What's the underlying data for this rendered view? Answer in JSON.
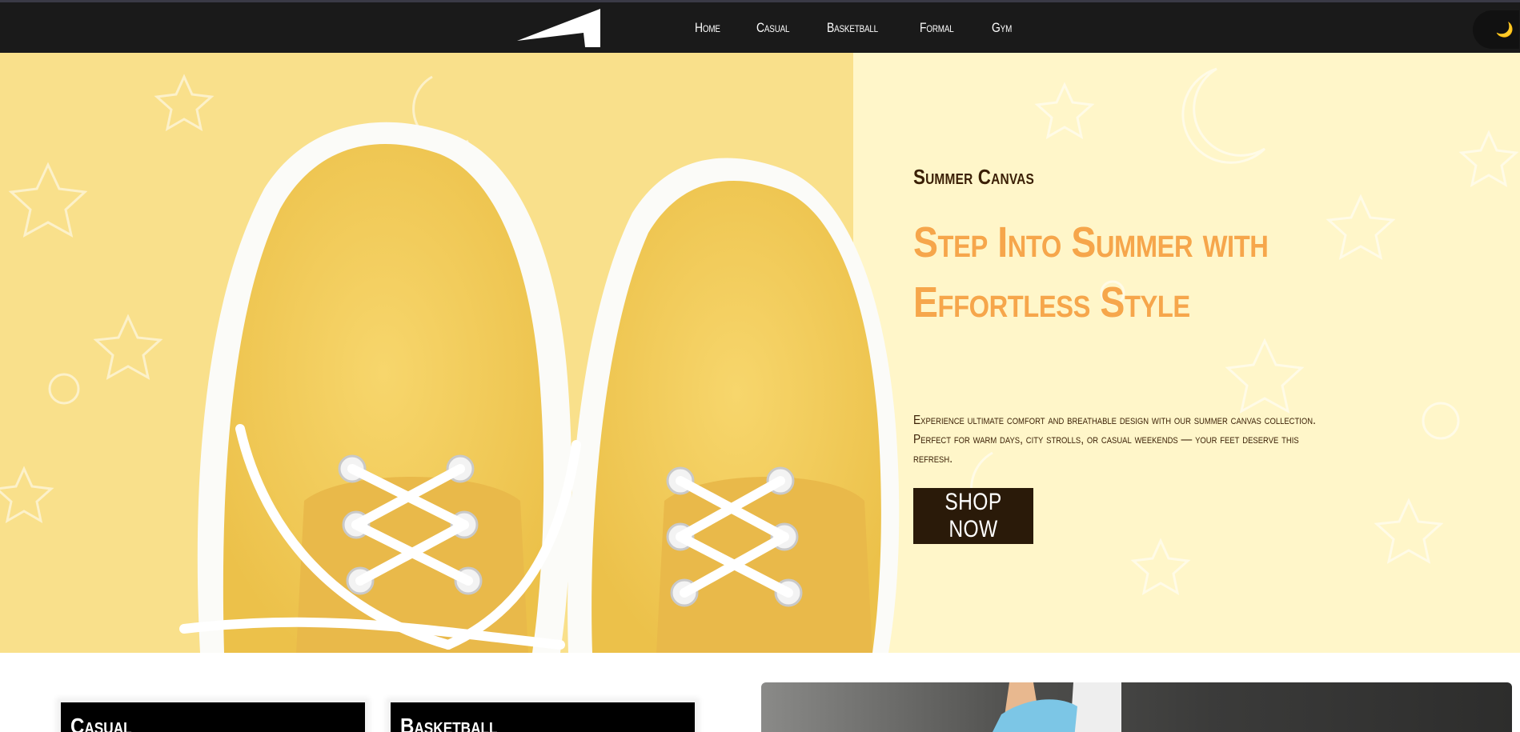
{
  "nav": {
    "items": [
      {
        "label": "Home"
      },
      {
        "label": "Casual"
      },
      {
        "label": "Basketball"
      },
      {
        "label": "Formal"
      },
      {
        "label": "Gym"
      }
    ],
    "theme_toggle_icon": "moon-icon"
  },
  "hero": {
    "eyebrow": "Summer Canvas",
    "headline": "Step Into Summer with Effortless Style",
    "description": "Experience ultimate comfort and breathable design with our summer canvas collection. Perfect for warm days, city strolls, or casual weekends — your feet deserve this refresh.",
    "cta_label": "SHOP NOW"
  },
  "categories": [
    {
      "label": "Casual"
    },
    {
      "label": "Basketball"
    }
  ],
  "colors": {
    "nav_bg": "#1a1a1a",
    "hero_bg": "#fff6c9",
    "hero_left_bg": "#f9e08b",
    "accent": "#f6a64b",
    "text_dark": "#3a1f05",
    "button_bg": "#2a1a09"
  }
}
